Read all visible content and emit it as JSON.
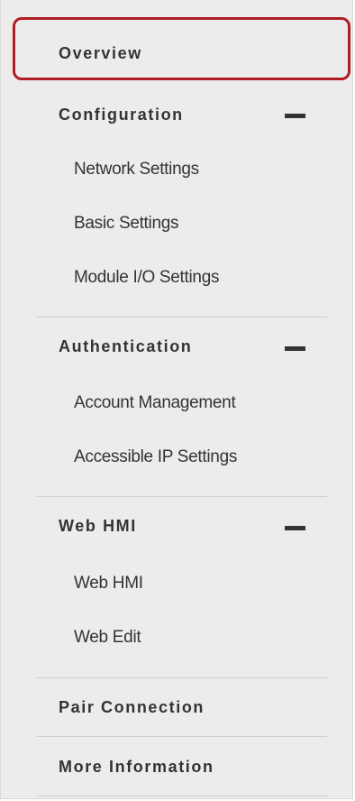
{
  "accent_color": "#b01e23",
  "sidebar": {
    "overview": {
      "label": "Overview"
    },
    "configuration": {
      "label": "Configuration",
      "items": [
        "Network Settings",
        "Basic Settings",
        "Module I/O Settings"
      ]
    },
    "authentication": {
      "label": "Authentication",
      "items": [
        "Account Management",
        "Accessible IP Settings"
      ]
    },
    "web_hmi": {
      "label": "Web HMI",
      "items": [
        "Web HMI",
        "Web Edit"
      ]
    },
    "pair_connection": {
      "label": "Pair Connection"
    },
    "more_information": {
      "label": "More Information"
    }
  },
  "icons": {
    "collapse": "minus-icon"
  }
}
